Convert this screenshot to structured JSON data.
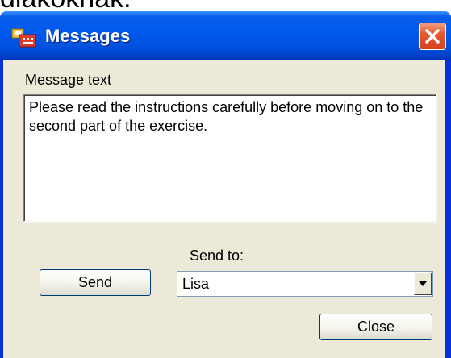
{
  "page_top_text": "diakokhak.",
  "window": {
    "title": "Messages",
    "close_icon": "close-icon",
    "app_icon": "app-icon"
  },
  "form": {
    "message_label": "Message text",
    "message_value": "Please read the instructions carefully before moving on to the second part of the exercise.",
    "send_to_label": "Send to:",
    "send_to_value": "Lisa",
    "send_button": "Send",
    "close_button": "Close"
  },
  "colors": {
    "titlebar": "#0058ee",
    "client_bg": "#ece9d8",
    "close_button": "#e5582e"
  }
}
